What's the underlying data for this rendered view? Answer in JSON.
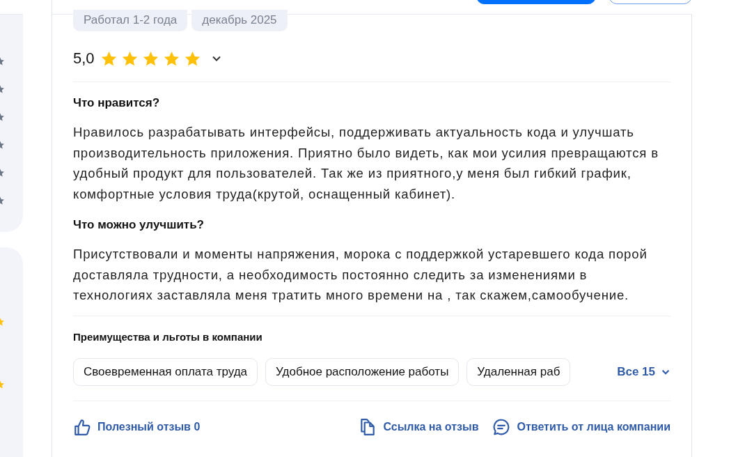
{
  "header": {
    "buttons": [
      {
        "kind": "primary"
      },
      {
        "kind": "outline"
      }
    ]
  },
  "review": {
    "tags": [
      "Работал 1-2 года",
      "декабрь 2025"
    ],
    "rating": {
      "value": "5,0",
      "stars": 5
    },
    "sections": [
      {
        "title": "Что нравится?",
        "text": "Нравилось разрабатывать интерфейсы, поддерживать актуальность кода и улучшать производительность приложения. Приятно было видеть, как мои усилия превращаются в удобный продукт для пользователей. Так же из приятного,у меня был гибкий график, комфортные условия труда(крутой, оснащенный кабинет)."
      },
      {
        "title": "Что можно улучшить?",
        "text": "Присутствовали и моменты напряжения, морока с поддержкой устаревшего кода порой доставляла трудности, а необходимость постоянно следить за изменениями в технологиях заставляла меня тратить много времени на , так скажем,самообучение."
      }
    ],
    "benefits": {
      "title": "Преимущества и льготы в компании",
      "items": [
        "Своевременная оплата труда",
        "Удобное расположение работы",
        "Удаленная раб"
      ],
      "more": "Все 15"
    },
    "actions": [
      {
        "kind": "like",
        "label": "Полезный отзыв 0"
      },
      {
        "kind": "copy",
        "label": "Ссылка на отзыв"
      },
      {
        "kind": "reply",
        "label": "Ответить от лица компании"
      }
    ]
  }
}
